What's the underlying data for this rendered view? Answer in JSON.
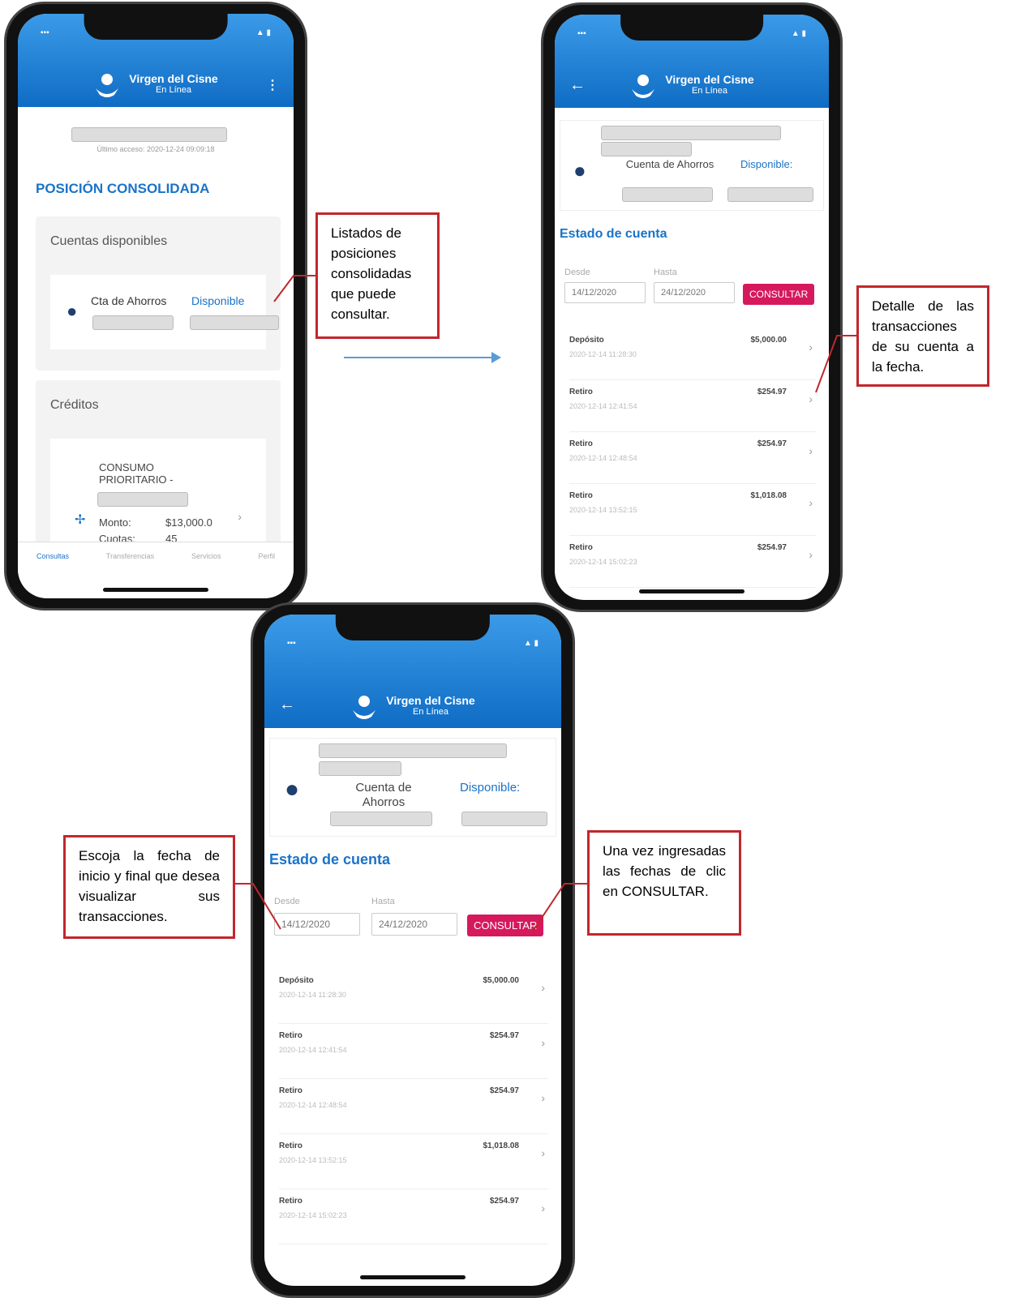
{
  "brand": {
    "name": "Virgen del Cisne",
    "sub": "En Línea"
  },
  "status": {
    "signal": "▪▪▪",
    "battery": "▲ ▮"
  },
  "icons": {
    "back": "arrow-left-icon",
    "menu": "more-vertical-icon",
    "user": "user-icon",
    "chevron": "chevron-right-icon",
    "credit": "credit-icon"
  },
  "phone1": {
    "last_access": "Último acceso: 2020-12-24 09:09:18",
    "section_title": "POSICIÓN CONSOLIDADA",
    "accounts_title": "Cuentas disponibles",
    "account_name": "Cta de Ahorros",
    "account_available": "Disponible",
    "credits_title": "Créditos",
    "credit_name": "CONSUMO PRIORITARIO -",
    "credit_amount_label": "Monto:",
    "credit_amount": "$13,000.0",
    "credit_cuotas_label": "Cuotas:",
    "credit_cuotas": "45",
    "nav": [
      "Consultas",
      "Transferencias",
      "Servicios",
      "Perfil"
    ]
  },
  "account": {
    "type": "Cuenta de Ahorros",
    "available_label": "Disponible:",
    "statement_title": "Estado de cuenta",
    "from_label": "Desde",
    "from_value": "14/12/2020",
    "to_label": "Hasta",
    "to_value": "24/12/2020",
    "button": "CONSULTAR"
  },
  "transactions": [
    {
      "type": "Depósito",
      "date": "2020-12-14 11:28:30",
      "amount": "$5,000.00"
    },
    {
      "type": "Retiro",
      "date": "2020-12-14 12:41:54",
      "amount": "$254.97"
    },
    {
      "type": "Retiro",
      "date": "2020-12-14 12:48:54",
      "amount": "$254.97"
    },
    {
      "type": "Retiro",
      "date": "2020-12-14 13:52:15",
      "amount": "$1,018.08"
    },
    {
      "type": "Retiro",
      "date": "2020-12-14 15:02:23",
      "amount": "$254.97"
    }
  ],
  "callouts": {
    "c1": "Listados de posiciones consolidadas que puede consultar.",
    "c2": "Detalle de las transacciones de su cuenta a la fecha.",
    "c3": "Escoja la fecha de inicio y final que desea visualizar sus transacciones.",
    "c4": "Una vez ingresadas las fechas de clic en CONSULTAR."
  },
  "colors": {
    "header": "#1a80d9",
    "button": "#d6195c",
    "callout_border": "#c1272d",
    "arrow": "#5b9bd5"
  }
}
